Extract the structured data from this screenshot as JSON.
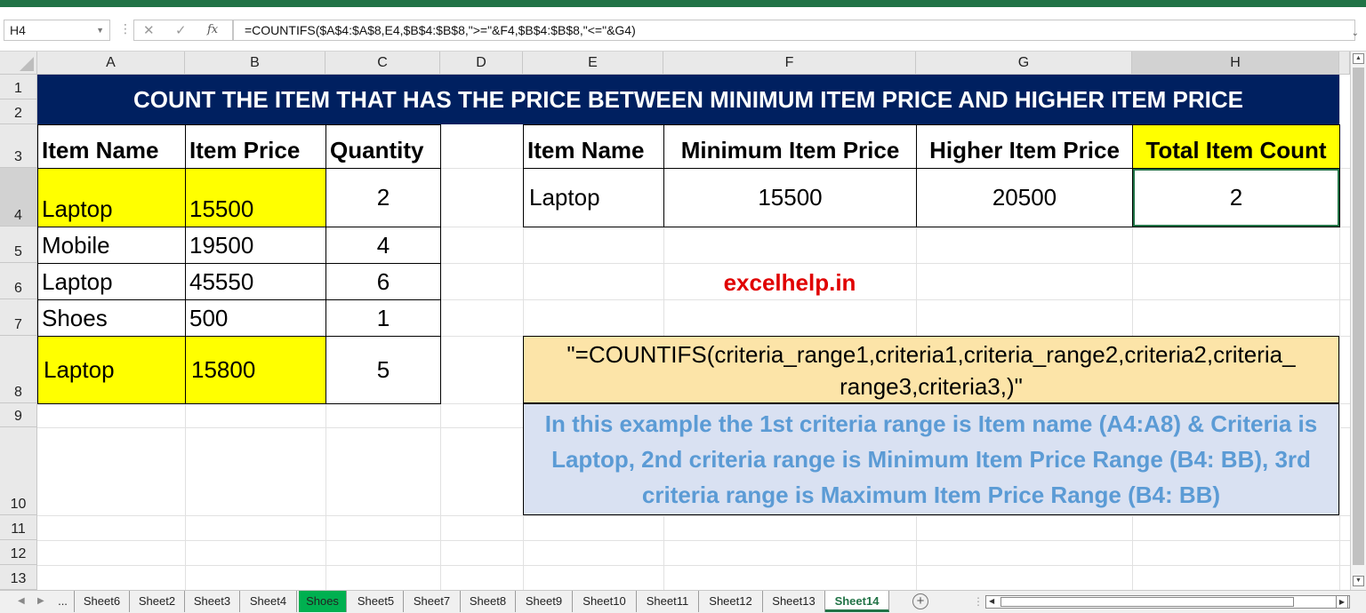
{
  "formula_bar": {
    "name_box": "H4",
    "cancel_glyph": "✕",
    "enter_glyph": "✓",
    "fx_label": "fx",
    "formula": "=COUNTIFS($A$4:$A$8,E4,$B$4:$B$8,\">=\"&F4,$B$4:$B$8,\"<=\"&G4)"
  },
  "columns": [
    "A",
    "B",
    "C",
    "D",
    "E",
    "F",
    "G",
    "H"
  ],
  "rows": [
    "1",
    "2",
    "3",
    "4",
    "5",
    "6",
    "7",
    "8",
    "9",
    "10",
    "11",
    "12",
    "13"
  ],
  "banner": "COUNT THE ITEM THAT HAS THE PRICE BETWEEN MINIMUM ITEM PRICE AND HIGHER ITEM PRICE",
  "left_table": {
    "headers": [
      "Item Name",
      "Item Price",
      "Quantity"
    ],
    "rows": [
      [
        "Laptop",
        "15500",
        "2"
      ],
      [
        "Mobile",
        "19500",
        "4"
      ],
      [
        "Laptop",
        "45550",
        "6"
      ],
      [
        "Shoes",
        "500",
        "1"
      ],
      [
        "Laptop",
        "15800",
        "5"
      ]
    ]
  },
  "right_table": {
    "headers": [
      "Item Name",
      "Minimum Item Price",
      "Higher Item Price",
      "Total Item Count"
    ],
    "row": [
      "Laptop",
      "15500",
      "20500",
      "2"
    ]
  },
  "site": "excelhelp.in",
  "syntax": "\"=COUNTIFS(criteria_range1,criteria1,criteria_range2,criteria2,criteria_ range3,criteria3,)\"",
  "explanation": "In this example the 1st criteria range is Item name (A4:A8) & Criteria is Laptop, 2nd criteria range is Minimum Item Price Range (B4: BB), 3rd criteria range is Maximum Item Price Range (B4: BB)",
  "sheet_tabs": {
    "ellipsis": "...",
    "tabs": [
      "Sheet6",
      "Sheet2",
      "Sheet3",
      "Sheet4",
      "Shoes",
      "Sheet5",
      "Sheet7",
      "Sheet8",
      "Sheet9",
      "Sheet10",
      "Sheet11",
      "Sheet12",
      "Sheet13",
      "Sheet14"
    ],
    "active": "Sheet14",
    "highlighted": "Shoes",
    "add_glyph": "+"
  },
  "colors": {
    "excel_green": "#217346",
    "banner_bg": "#002060",
    "highlight_yellow": "#ffff00",
    "site_red": "#e00000",
    "syntax_bg": "#fce4a8",
    "explain_bg": "#d9e1f2",
    "explain_text": "#5b9bd5",
    "shoes_tab": "#00b050"
  },
  "icons": [
    "dropdown-arrow-icon",
    "cancel-icon",
    "enter-icon",
    "fx-icon",
    "expand-formula-bar-icon",
    "select-all-icon",
    "scroll-up-icon",
    "scroll-down-icon",
    "tab-prev-icon",
    "tab-next-icon",
    "add-sheet-icon",
    "scroll-left-icon",
    "scroll-right-icon"
  ]
}
